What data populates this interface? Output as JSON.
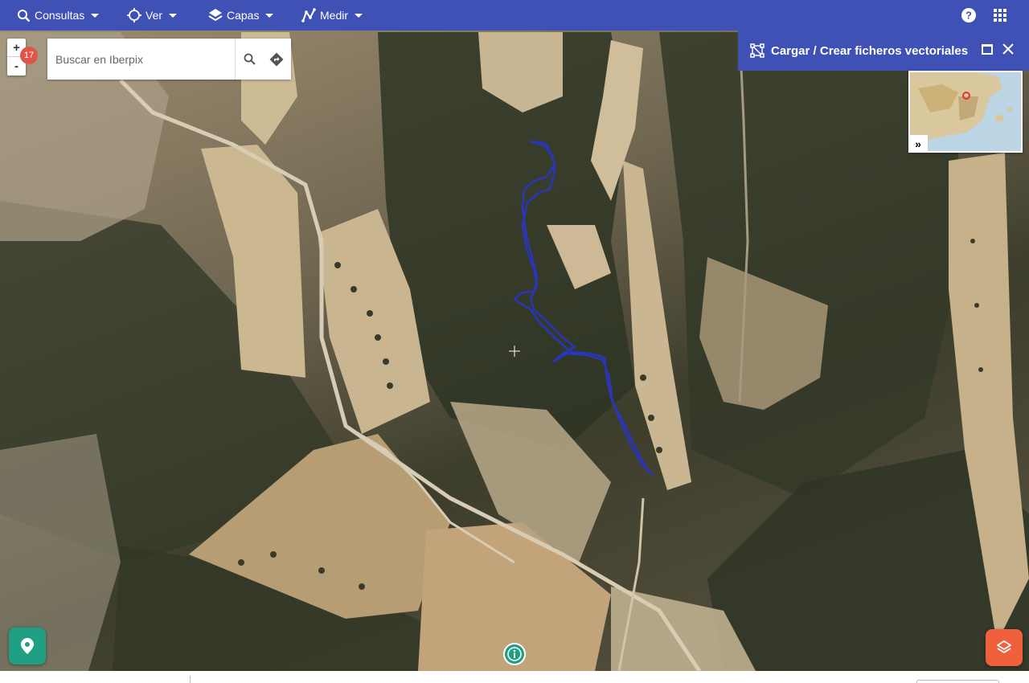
{
  "toolbar": {
    "consultas_label": "Consultas",
    "ver_label": "Ver",
    "capas_label": "Capas",
    "medir_label": "Medir",
    "help_icon": "help-circle-icon",
    "apps_icon": "grid-apps-icon"
  },
  "zoom": {
    "in_label": "+",
    "out_label": "-",
    "level_badge": "17"
  },
  "search": {
    "placeholder": "Buscar en Iberpix",
    "value": ""
  },
  "panel": {
    "title": "Cargar / Crear ficheros vectoriales"
  },
  "overview": {
    "toggle_label": "»"
  },
  "colors": {
    "toolbar_bg": "#3f51b5",
    "track_line": "#2a35b8",
    "fab_location": "#1fa083",
    "fab_layers": "#f0603c",
    "zoom_badge": "#e0554a"
  },
  "icons": {
    "location": "map-pin-icon",
    "layers": "layers-icon",
    "info": "info-icon",
    "crosshair": "crosshair-icon"
  }
}
